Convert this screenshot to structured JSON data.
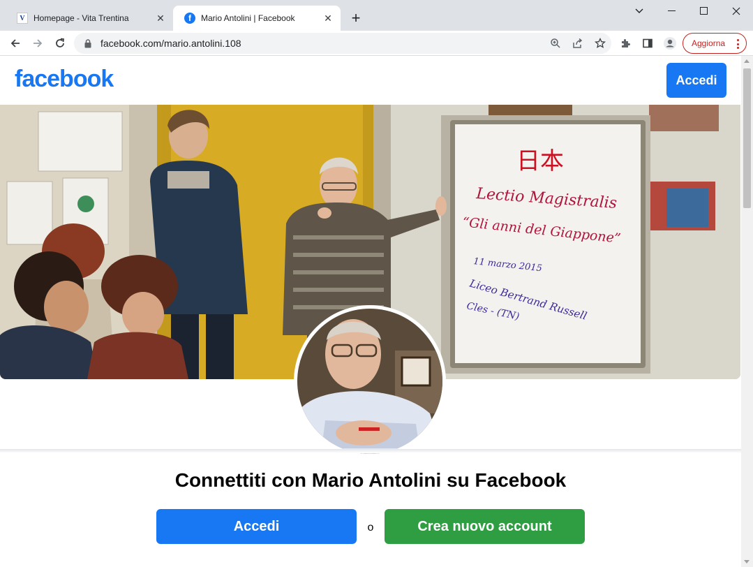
{
  "browser": {
    "tabs": [
      {
        "title": "Homepage - Vita Trentina",
        "favicon": "vita-trentina-favicon",
        "active": false
      },
      {
        "title": "Mario Antolini | Facebook",
        "favicon": "facebook-favicon",
        "active": true
      }
    ],
    "url": "facebook.com/mario.antolini.108",
    "update_label": "Aggiorna"
  },
  "page": {
    "logo_text": "facebook",
    "header_login_label": "Accedi",
    "cover_whiteboard": {
      "kanji": "日本",
      "line1": "Lectio Magistralis",
      "line2": "“Gli anni del Giappone”",
      "line3": "11 marzo 2015",
      "line4": "Liceo Bertrand Russell",
      "line5": "Cles - (TN)"
    },
    "connect_title": "Connettiti con Mario Antolini su Facebook",
    "login_label": "Accedi",
    "or_label": "o",
    "create_label": "Crea nuovo account"
  },
  "colors": {
    "facebook_blue": "#1877f2",
    "create_green": "#2f9e43",
    "update_red": "#c5221f"
  }
}
